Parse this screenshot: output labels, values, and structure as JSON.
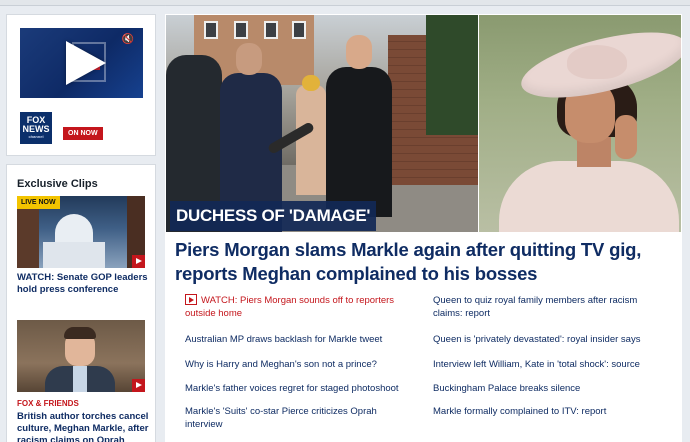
{
  "sidebar": {
    "player": {
      "network_logo_text": "FOX NEWS",
      "network_logo_sub": "channel",
      "on_now_label": "ON NOW"
    },
    "clips": {
      "title": "Exclusive Clips",
      "items": [
        {
          "badge": "LIVE NOW",
          "headline": "WATCH: Senate GOP leaders hold press conference"
        },
        {
          "kicker": "FOX & FRIENDS",
          "headline": "British author torches cancel culture, Meghan Markle, after racism claims on Oprah"
        }
      ]
    }
  },
  "main": {
    "banner": "DUCHESS OF 'DAMAGE'",
    "headline": "Piers Morgan slams Markle again after quitting TV gig, reports Meghan complained to his bosses",
    "links_left": [
      "WATCH: Piers Morgan sounds off to reporters outside home",
      "Australian MP draws backlash for Markle tweet",
      "Why is Harry and Meghan's son not a prince?",
      "Markle's father voices regret for staged photoshoot",
      "Markle's 'Suits' co-star Pierce criticizes Oprah interview"
    ],
    "links_right": [
      "Queen to quiz royal family members after racism claims: report",
      "Queen is 'privately devastated': royal insider says",
      "Interview left William, Kate in 'total shock': source",
      "Buckingham Palace breaks silence",
      "Markle formally complained to ITV: report"
    ]
  },
  "colors": {
    "brand_navy": "#0f2c63",
    "alert_red": "#c4161c",
    "live_yellow": "#f3c400"
  }
}
